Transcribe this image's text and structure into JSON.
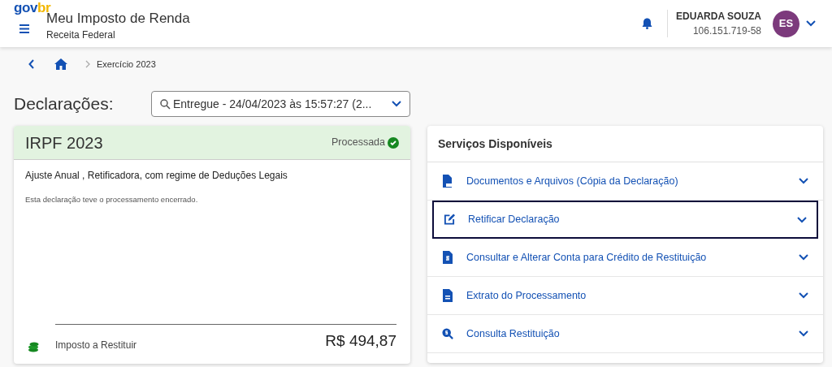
{
  "header": {
    "logo_parts": [
      "gov",
      "br"
    ],
    "title": "Meu Imposto de Renda",
    "subtitle": "Receita Federal",
    "user_name": "EDUARDA SOUZA",
    "user_id": "106.151.719-58",
    "avatar_initials": "ES"
  },
  "breadcrumb": {
    "items": [
      "Exercício 2023"
    ]
  },
  "declarations": {
    "label": "Declarações:",
    "select_value": "Entregue - 24/04/2023 às 15:57:27 (2..."
  },
  "declaration_card": {
    "title": "IRPF 2023",
    "status": "Processada",
    "processed": true,
    "type": "Ajuste Anual , Retificadora, com regime de Deduções Legais",
    "note": "Esta declaração teve o processamento encerrado.",
    "amount_label": "Imposto a Restituir",
    "amount": "R$ 494,87"
  },
  "services": {
    "title": "Serviços Disponíveis",
    "items": [
      {
        "label": "Documentos e Arquivos (Cópia da Declaração)",
        "kind": "pdf",
        "selected": false
      },
      {
        "label": "Retificar Declaração",
        "kind": "edit",
        "selected": true
      },
      {
        "label": "Consultar e Alterar Conta para Crédito de Restituição",
        "kind": "money-doc",
        "selected": false
      },
      {
        "label": "Extrato do Processamento",
        "kind": "doc",
        "selected": false
      },
      {
        "label": "Consulta Restituição",
        "kind": "search-money",
        "selected": false
      }
    ]
  }
}
